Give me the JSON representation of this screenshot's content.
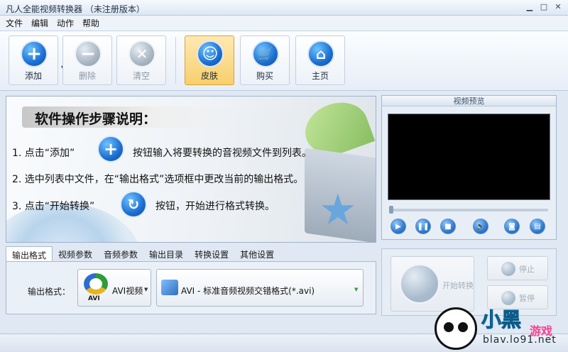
{
  "window": {
    "title": "凡人全能视频转换器 （未注册版本）"
  },
  "menu": [
    "文件",
    "编辑",
    "动作",
    "帮助"
  ],
  "toolbar": {
    "add": "添加",
    "delete": "删除",
    "clear": "清空",
    "skin": "皮肤",
    "buy": "购买",
    "home": "主页"
  },
  "guide": {
    "title": "软件操作步骤说明：",
    "step1_a": "1. 点击“添加”",
    "step1_b": "按钮输入将要转换的音视频文件到列表。",
    "step2": "2. 选中列表中文件，在“输出格式”选项框中更改当前的输出格式。",
    "step3_a": "3. 点击“开始转换”",
    "step3_b": "按钮，开始进行格式转换。"
  },
  "preview": {
    "title": "视频预览"
  },
  "tabs": [
    "输出格式",
    "视频参数",
    "音频参数",
    "输出目录",
    "转换设置",
    "其他设置"
  ],
  "output": {
    "label": "输出格式：",
    "format": "AVI视频",
    "logo_text": "AVI",
    "profile": "AVI - 标准音频视频交错格式(*.avi)"
  },
  "actions": {
    "start": "开始转换",
    "stop": "停止",
    "pause": "暂停"
  },
  "watermark": {
    "brand": "小黑",
    "tag": "游戏",
    "url": "blav.lo91.net"
  },
  "colors": {
    "accent": "#1b6fd1",
    "skin_active": "#f7cf6b"
  }
}
